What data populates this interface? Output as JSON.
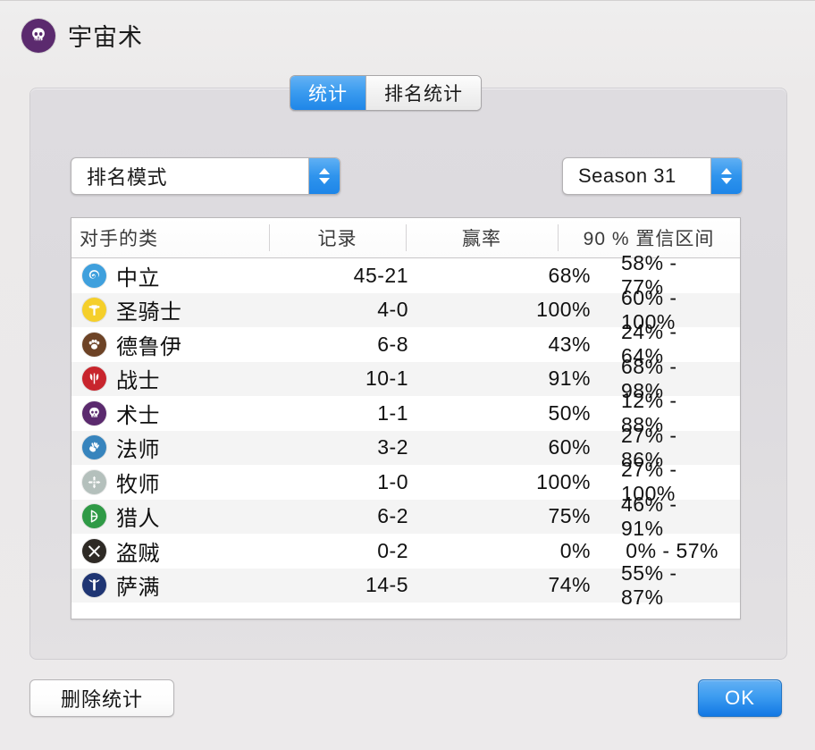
{
  "header": {
    "title": "宇宙术",
    "icon": "warlock-skull-icon"
  },
  "tabs": [
    {
      "label": "统计",
      "active": true
    },
    {
      "label": "排名统计",
      "active": false
    }
  ],
  "controls": {
    "mode": {
      "value": "排名模式",
      "icon": "stepper-arrows-icon"
    },
    "season": {
      "value": "Season 31",
      "icon": "stepper-arrows-icon"
    }
  },
  "table": {
    "columns": [
      "对手的类",
      "记录",
      "赢率",
      "90 % 置信区间"
    ],
    "rows": [
      {
        "icon": "neutral-icon",
        "class_name": "中立",
        "record": "45-21",
        "winrate": "68%",
        "ci": "58% -  77%",
        "color": "#3fa0dd"
      },
      {
        "icon": "paladin-icon",
        "class_name": "圣骑士",
        "record": "4-0",
        "winrate": "100%",
        "ci": "60% - 100%",
        "color": "#f5cf2a"
      },
      {
        "icon": "druid-icon",
        "class_name": "德鲁伊",
        "record": "6-8",
        "winrate": "43%",
        "ci": "24% -  64%",
        "color": "#6d4326"
      },
      {
        "icon": "warrior-icon",
        "class_name": "战士",
        "record": "10-1",
        "winrate": "91%",
        "ci": "68% -  98%",
        "color": "#c8252d"
      },
      {
        "icon": "warlock-icon",
        "class_name": "术士",
        "record": "1-1",
        "winrate": "50%",
        "ci": "12% -  88%",
        "color": "#5b2a6e"
      },
      {
        "icon": "mage-icon",
        "class_name": "法师",
        "record": "3-2",
        "winrate": "60%",
        "ci": "27% -  86%",
        "color": "#3784bd"
      },
      {
        "icon": "priest-icon",
        "class_name": "牧师",
        "record": "1-0",
        "winrate": "100%",
        "ci": "27% - 100%",
        "color": "#b4c0bc"
      },
      {
        "icon": "hunter-icon",
        "class_name": "猎人",
        "record": "6-2",
        "winrate": "75%",
        "ci": "46% -  91%",
        "color": "#2f9a46"
      },
      {
        "icon": "rogue-icon",
        "class_name": "盗贼",
        "record": "0-2",
        "winrate": "0%",
        "ci": "0% -  57%",
        "color": "#2e2a25"
      },
      {
        "icon": "shaman-icon",
        "class_name": "萨满",
        "record": "14-5",
        "winrate": "74%",
        "ci": "55% -  87%",
        "color": "#1f3573"
      }
    ]
  },
  "footer": {
    "delete_label": "删除统计",
    "ok_label": "OK"
  },
  "colors": {
    "accent_blue": "#2f94ed",
    "window_bg": "#ecebeb",
    "panel_bg": "#dedce0",
    "row_alt": "#f4f4f4"
  }
}
